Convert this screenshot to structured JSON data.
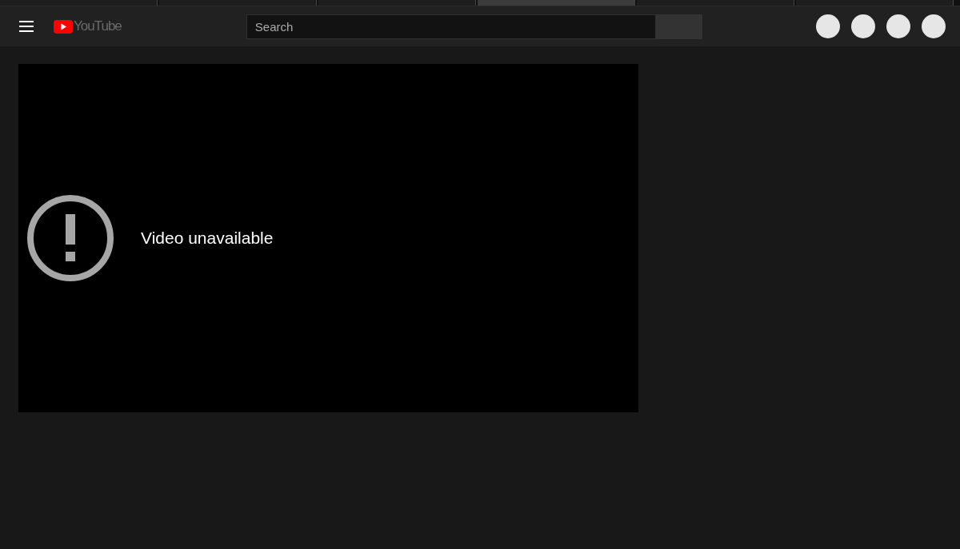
{
  "browser_tabs": [
    {
      "selected": false
    },
    {
      "selected": false
    },
    {
      "selected": false
    },
    {
      "selected": true
    },
    {
      "selected": false
    },
    {
      "selected": false
    }
  ],
  "header": {
    "logo_text": "YouTube",
    "search": {
      "placeholder": "Search"
    }
  },
  "player": {
    "message": "Video unavailable"
  }
}
